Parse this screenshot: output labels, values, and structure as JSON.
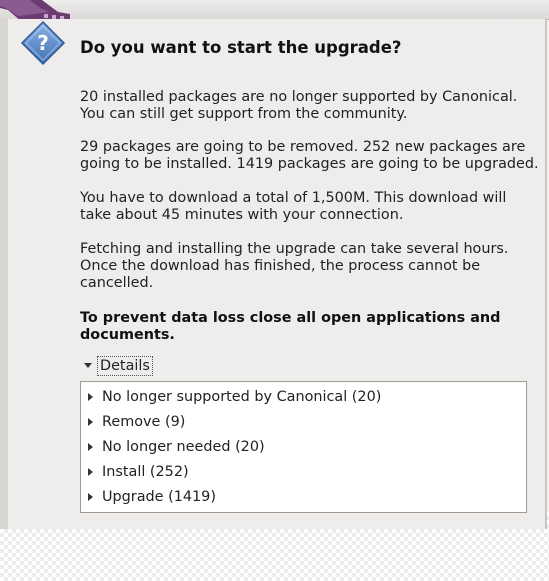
{
  "dialog": {
    "icon": "question-icon",
    "heading": "Do you want to start the upgrade?",
    "paragraphs": [
      [
        "20 installed packages are no longer supported by Canonical.",
        "You can still get support from the community."
      ],
      [
        "29 packages are going to be removed. 252 new packages are",
        "going to be installed. 1419 packages are going to be upgraded."
      ],
      [
        "You have to download a total of 1,500M. This download will",
        "take about 45 minutes with your connection."
      ],
      [
        "Fetching and installing the upgrade can take several hours.",
        "Once the download has finished, the process cannot be",
        "cancelled."
      ]
    ],
    "warning": [
      "To prevent data loss close all open applications and",
      "documents."
    ]
  },
  "details": {
    "label": "Details",
    "expanded": true,
    "items": [
      {
        "label": "No longer supported by Canonical (20)"
      },
      {
        "label": "Remove (9)"
      },
      {
        "label": "No longer needed (20)"
      },
      {
        "label": "Install (252)"
      },
      {
        "label": "Upgrade (1419)"
      }
    ]
  },
  "colors": {
    "window_bg": "#efedeb",
    "icon_blue": "#4a78b8",
    "theme_purple": "#7a4a80"
  }
}
